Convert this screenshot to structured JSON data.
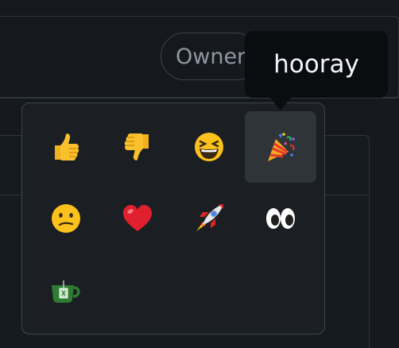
{
  "header": {
    "owner_label": "Owner",
    "more_label": "..."
  },
  "tooltip": {
    "text": "hooray"
  },
  "reactions": [
    {
      "name": "thumbs-up",
      "selected": false
    },
    {
      "name": "thumbs-down",
      "selected": false
    },
    {
      "name": "laugh",
      "selected": false
    },
    {
      "name": "hooray",
      "selected": true
    },
    {
      "name": "confused",
      "selected": false
    },
    {
      "name": "heart",
      "selected": false
    },
    {
      "name": "rocket",
      "selected": false
    },
    {
      "name": "eyes",
      "selected": false
    },
    {
      "name": "tea",
      "selected": false
    }
  ],
  "colors": {
    "background": "#15181d",
    "popover": "#1b1f24",
    "border": "#3d444d",
    "tooltip": "#0a0c10",
    "hover": "#2f3439"
  }
}
